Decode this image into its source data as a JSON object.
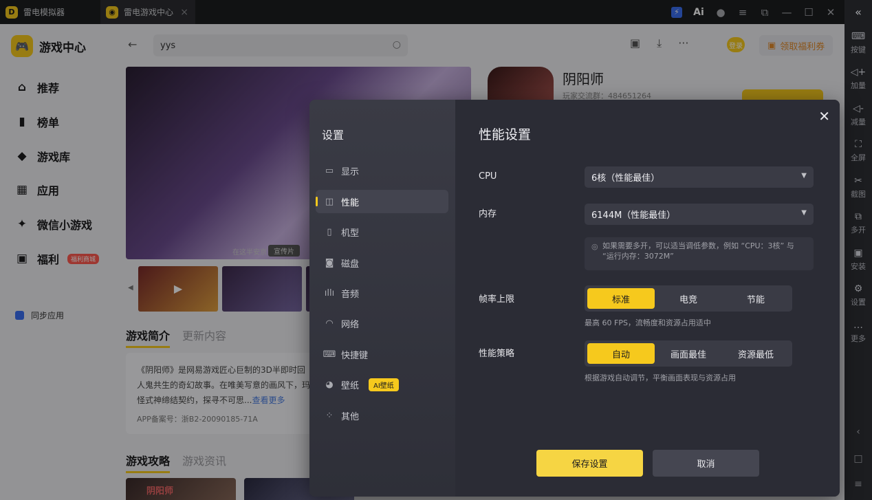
{
  "titlebar": {
    "tabs": [
      {
        "label": "雷电模拟器"
      },
      {
        "label": "雷电游戏中心"
      }
    ],
    "ai_label": "Ai"
  },
  "right_toolbar": {
    "items": [
      {
        "label": "按键",
        "icon": "keyboard-icon"
      },
      {
        "label": "加量",
        "icon": "volume-up-icon"
      },
      {
        "label": "减量",
        "icon": "volume-down-icon"
      },
      {
        "label": "全屏",
        "icon": "fullscreen-icon"
      },
      {
        "label": "截图",
        "icon": "scissors-icon"
      },
      {
        "label": "多开",
        "icon": "multi-instance-icon"
      },
      {
        "label": "安装",
        "icon": "install-icon"
      },
      {
        "label": "设置",
        "icon": "gear-icon"
      },
      {
        "label": "更多",
        "icon": "more-icon"
      }
    ]
  },
  "sidebar": {
    "brand": "游戏中心",
    "items": [
      {
        "label": "推荐",
        "icon": "home-icon"
      },
      {
        "label": "榜单",
        "icon": "chart-icon"
      },
      {
        "label": "游戏库",
        "icon": "gamepad-icon"
      },
      {
        "label": "应用",
        "icon": "apps-icon"
      },
      {
        "label": "微信小游戏",
        "icon": "mini-game-icon"
      },
      {
        "label": "福利",
        "icon": "gift-icon"
      }
    ],
    "welfare_badge": "福利商城",
    "sync_label": "同步应用"
  },
  "header": {
    "search_value": "yys",
    "login_label": "登录",
    "welfare_button": "领取福利券"
  },
  "game": {
    "title": "阴阳师",
    "group_label": "玩家交流群：484651264",
    "banner_caption": "在这半安京",
    "promo_badge": "宣传片",
    "tab_intro": "游戏简介",
    "tab_updates": "更新内容",
    "intro_text_line1": "《阴阳师》是网易游戏匠心巨制的3D半即时回",
    "intro_text_line2": "人鬼共生的奇幻故事。在唯美写意的画风下，玛",
    "intro_text_line3": "怪式神缔结契约，探寻不可思...",
    "intro_more": "查看更多",
    "app_record": "APP备案号：浙B2-20090185-71A",
    "tab_guides": "游戏攻略",
    "tab_news": "游戏资讯",
    "guide_label": "阴阳师"
  },
  "modal": {
    "side_title": "设置",
    "side_items": [
      {
        "label": "显示",
        "icon": "monitor-icon"
      },
      {
        "label": "性能",
        "icon": "performance-icon"
      },
      {
        "label": "机型",
        "icon": "phone-icon"
      },
      {
        "label": "磁盘",
        "icon": "disk-icon"
      },
      {
        "label": "音频",
        "icon": "audio-icon"
      },
      {
        "label": "网络",
        "icon": "wifi-icon"
      },
      {
        "label": "快捷键",
        "icon": "keyboard-icon"
      },
      {
        "label": "壁纸",
        "icon": "palette-icon"
      },
      {
        "label": "其他",
        "icon": "grid-icon"
      }
    ],
    "ai_wallpaper_badge": "AI壁纸",
    "title": "性能设置",
    "cpu_label": "CPU",
    "cpu_value": "6核（性能最佳）",
    "memory_label": "内存",
    "memory_value": "6144M（性能最佳）",
    "memory_hint": "如果需要多开，可以适当调低参数，例如 “CPU：3核” 与 “运行内存：3072M”",
    "fps_label": "帧率上限",
    "fps_options": [
      "标准",
      "电竞",
      "节能"
    ],
    "fps_hint": "最高 60 FPS，流畅度和资源占用适中",
    "strategy_label": "性能策略",
    "strategy_options": [
      "自动",
      "画面最佳",
      "资源最低"
    ],
    "strategy_hint": "根据游戏自动调节，平衡画面表现与资源占用",
    "save_button": "保存设置",
    "cancel_button": "取消"
  }
}
